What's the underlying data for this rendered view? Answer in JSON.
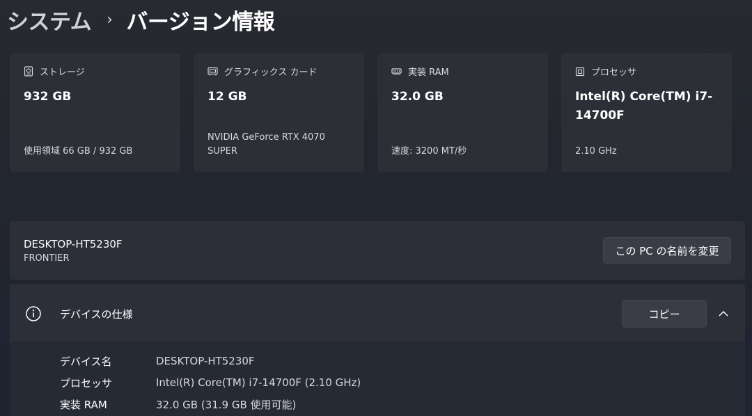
{
  "breadcrumb": {
    "parent": "システム",
    "separator": "›",
    "current": "バージョン情報"
  },
  "cards": [
    {
      "icon": "storage-drive-icon",
      "title": "ストレージ",
      "value": "932 GB",
      "detail": "使用領域 66 GB / 932 GB"
    },
    {
      "icon": "graphics-card-icon",
      "title": "グラフィックス カード",
      "value": "12 GB",
      "detail": "NVIDIA GeForce RTX 4070 SUPER"
    },
    {
      "icon": "memory-ram-icon",
      "title": "実装 RAM",
      "value": "32.0 GB",
      "detail": "速度: 3200 MT/秒"
    },
    {
      "icon": "processor-chip-icon",
      "title": "プロセッサ",
      "value": "Intel(R) Core(TM) i7-14700F",
      "detail": "2.10 GHz"
    }
  ],
  "device": {
    "name": "DESKTOP-HT5230F",
    "model": "FRONTIER",
    "rename_label": "この PC の名前を変更"
  },
  "specs": {
    "title": "デバイスの仕様",
    "copy_label": "コピー",
    "rows": [
      {
        "label": "デバイス名",
        "value": "DESKTOP-HT5230F"
      },
      {
        "label": "プロセッサ",
        "value": "Intel(R) Core(TM) i7-14700F (2.10 GHz)"
      },
      {
        "label": "実装 RAM",
        "value": "32.0 GB (31.9 GB 使用可能)"
      }
    ]
  }
}
